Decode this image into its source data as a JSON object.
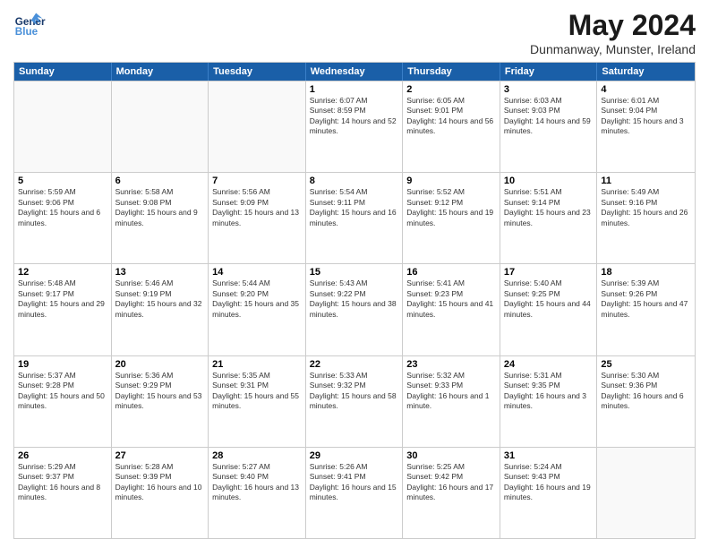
{
  "header": {
    "logo": {
      "general": "General",
      "blue": "Blue"
    },
    "month_year": "May 2024",
    "location": "Dunmanway, Munster, Ireland"
  },
  "days_of_week": [
    "Sunday",
    "Monday",
    "Tuesday",
    "Wednesday",
    "Thursday",
    "Friday",
    "Saturday"
  ],
  "weeks": [
    [
      {
        "day": "",
        "sunrise": "",
        "sunset": "",
        "daylight": "",
        "empty": true
      },
      {
        "day": "",
        "sunrise": "",
        "sunset": "",
        "daylight": "",
        "empty": true
      },
      {
        "day": "",
        "sunrise": "",
        "sunset": "",
        "daylight": "",
        "empty": true
      },
      {
        "day": "1",
        "sunrise": "Sunrise: 6:07 AM",
        "sunset": "Sunset: 8:59 PM",
        "daylight": "Daylight: 14 hours and 52 minutes.",
        "empty": false
      },
      {
        "day": "2",
        "sunrise": "Sunrise: 6:05 AM",
        "sunset": "Sunset: 9:01 PM",
        "daylight": "Daylight: 14 hours and 56 minutes.",
        "empty": false
      },
      {
        "day": "3",
        "sunrise": "Sunrise: 6:03 AM",
        "sunset": "Sunset: 9:03 PM",
        "daylight": "Daylight: 14 hours and 59 minutes.",
        "empty": false
      },
      {
        "day": "4",
        "sunrise": "Sunrise: 6:01 AM",
        "sunset": "Sunset: 9:04 PM",
        "daylight": "Daylight: 15 hours and 3 minutes.",
        "empty": false
      }
    ],
    [
      {
        "day": "5",
        "sunrise": "Sunrise: 5:59 AM",
        "sunset": "Sunset: 9:06 PM",
        "daylight": "Daylight: 15 hours and 6 minutes.",
        "empty": false
      },
      {
        "day": "6",
        "sunrise": "Sunrise: 5:58 AM",
        "sunset": "Sunset: 9:08 PM",
        "daylight": "Daylight: 15 hours and 9 minutes.",
        "empty": false
      },
      {
        "day": "7",
        "sunrise": "Sunrise: 5:56 AM",
        "sunset": "Sunset: 9:09 PM",
        "daylight": "Daylight: 15 hours and 13 minutes.",
        "empty": false
      },
      {
        "day": "8",
        "sunrise": "Sunrise: 5:54 AM",
        "sunset": "Sunset: 9:11 PM",
        "daylight": "Daylight: 15 hours and 16 minutes.",
        "empty": false
      },
      {
        "day": "9",
        "sunrise": "Sunrise: 5:52 AM",
        "sunset": "Sunset: 9:12 PM",
        "daylight": "Daylight: 15 hours and 19 minutes.",
        "empty": false
      },
      {
        "day": "10",
        "sunrise": "Sunrise: 5:51 AM",
        "sunset": "Sunset: 9:14 PM",
        "daylight": "Daylight: 15 hours and 23 minutes.",
        "empty": false
      },
      {
        "day": "11",
        "sunrise": "Sunrise: 5:49 AM",
        "sunset": "Sunset: 9:16 PM",
        "daylight": "Daylight: 15 hours and 26 minutes.",
        "empty": false
      }
    ],
    [
      {
        "day": "12",
        "sunrise": "Sunrise: 5:48 AM",
        "sunset": "Sunset: 9:17 PM",
        "daylight": "Daylight: 15 hours and 29 minutes.",
        "empty": false
      },
      {
        "day": "13",
        "sunrise": "Sunrise: 5:46 AM",
        "sunset": "Sunset: 9:19 PM",
        "daylight": "Daylight: 15 hours and 32 minutes.",
        "empty": false
      },
      {
        "day": "14",
        "sunrise": "Sunrise: 5:44 AM",
        "sunset": "Sunset: 9:20 PM",
        "daylight": "Daylight: 15 hours and 35 minutes.",
        "empty": false
      },
      {
        "day": "15",
        "sunrise": "Sunrise: 5:43 AM",
        "sunset": "Sunset: 9:22 PM",
        "daylight": "Daylight: 15 hours and 38 minutes.",
        "empty": false
      },
      {
        "day": "16",
        "sunrise": "Sunrise: 5:41 AM",
        "sunset": "Sunset: 9:23 PM",
        "daylight": "Daylight: 15 hours and 41 minutes.",
        "empty": false
      },
      {
        "day": "17",
        "sunrise": "Sunrise: 5:40 AM",
        "sunset": "Sunset: 9:25 PM",
        "daylight": "Daylight: 15 hours and 44 minutes.",
        "empty": false
      },
      {
        "day": "18",
        "sunrise": "Sunrise: 5:39 AM",
        "sunset": "Sunset: 9:26 PM",
        "daylight": "Daylight: 15 hours and 47 minutes.",
        "empty": false
      }
    ],
    [
      {
        "day": "19",
        "sunrise": "Sunrise: 5:37 AM",
        "sunset": "Sunset: 9:28 PM",
        "daylight": "Daylight: 15 hours and 50 minutes.",
        "empty": false
      },
      {
        "day": "20",
        "sunrise": "Sunrise: 5:36 AM",
        "sunset": "Sunset: 9:29 PM",
        "daylight": "Daylight: 15 hours and 53 minutes.",
        "empty": false
      },
      {
        "day": "21",
        "sunrise": "Sunrise: 5:35 AM",
        "sunset": "Sunset: 9:31 PM",
        "daylight": "Daylight: 15 hours and 55 minutes.",
        "empty": false
      },
      {
        "day": "22",
        "sunrise": "Sunrise: 5:33 AM",
        "sunset": "Sunset: 9:32 PM",
        "daylight": "Daylight: 15 hours and 58 minutes.",
        "empty": false
      },
      {
        "day": "23",
        "sunrise": "Sunrise: 5:32 AM",
        "sunset": "Sunset: 9:33 PM",
        "daylight": "Daylight: 16 hours and 1 minute.",
        "empty": false
      },
      {
        "day": "24",
        "sunrise": "Sunrise: 5:31 AM",
        "sunset": "Sunset: 9:35 PM",
        "daylight": "Daylight: 16 hours and 3 minutes.",
        "empty": false
      },
      {
        "day": "25",
        "sunrise": "Sunrise: 5:30 AM",
        "sunset": "Sunset: 9:36 PM",
        "daylight": "Daylight: 16 hours and 6 minutes.",
        "empty": false
      }
    ],
    [
      {
        "day": "26",
        "sunrise": "Sunrise: 5:29 AM",
        "sunset": "Sunset: 9:37 PM",
        "daylight": "Daylight: 16 hours and 8 minutes.",
        "empty": false
      },
      {
        "day": "27",
        "sunrise": "Sunrise: 5:28 AM",
        "sunset": "Sunset: 9:39 PM",
        "daylight": "Daylight: 16 hours and 10 minutes.",
        "empty": false
      },
      {
        "day": "28",
        "sunrise": "Sunrise: 5:27 AM",
        "sunset": "Sunset: 9:40 PM",
        "daylight": "Daylight: 16 hours and 13 minutes.",
        "empty": false
      },
      {
        "day": "29",
        "sunrise": "Sunrise: 5:26 AM",
        "sunset": "Sunset: 9:41 PM",
        "daylight": "Daylight: 16 hours and 15 minutes.",
        "empty": false
      },
      {
        "day": "30",
        "sunrise": "Sunrise: 5:25 AM",
        "sunset": "Sunset: 9:42 PM",
        "daylight": "Daylight: 16 hours and 17 minutes.",
        "empty": false
      },
      {
        "day": "31",
        "sunrise": "Sunrise: 5:24 AM",
        "sunset": "Sunset: 9:43 PM",
        "daylight": "Daylight: 16 hours and 19 minutes.",
        "empty": false
      },
      {
        "day": "",
        "sunrise": "",
        "sunset": "",
        "daylight": "",
        "empty": true
      }
    ]
  ]
}
